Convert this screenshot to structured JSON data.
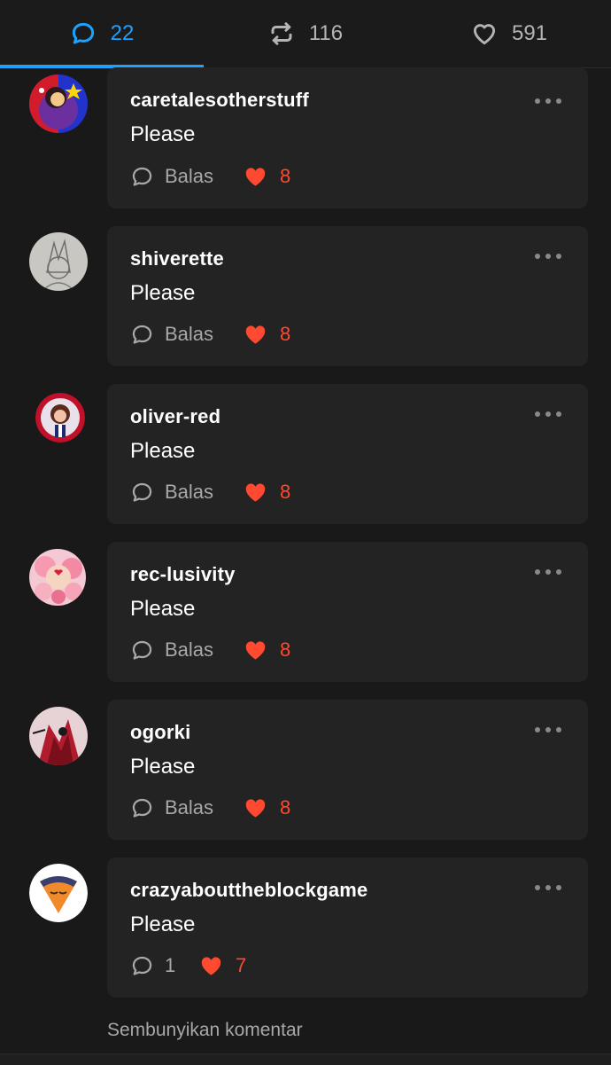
{
  "colors": {
    "background": "#191919",
    "card": "#232323",
    "accent": "#1fa1ff",
    "like": "#ff4930",
    "muted": "#a8a8a8"
  },
  "tabs": [
    {
      "icon": "comment-icon",
      "count": "22",
      "active": true
    },
    {
      "icon": "reblog-icon",
      "count": "116",
      "active": false
    },
    {
      "icon": "heart-outline-icon",
      "count": "591",
      "active": false
    }
  ],
  "comments": [
    {
      "username": "caretalesotherstuff",
      "text": "Please",
      "reply_label": "Balas",
      "likes": "8"
    },
    {
      "username": "shiverette",
      "text": "Please",
      "reply_label": "Balas",
      "likes": "8"
    },
    {
      "username": "oliver-red",
      "text": "Please",
      "reply_label": "Balas",
      "likes": "8"
    },
    {
      "username": "rec-lusivity",
      "text": "Please",
      "reply_label": "Balas",
      "likes": "8"
    },
    {
      "username": "ogorki",
      "text": "Please",
      "reply_label": "Balas",
      "likes": "8"
    },
    {
      "username": "crazyabouttheblockgame",
      "text": "Please",
      "reply_label": "1",
      "likes": "7"
    }
  ],
  "hide_comments_label": "Sembunyikan komentar"
}
